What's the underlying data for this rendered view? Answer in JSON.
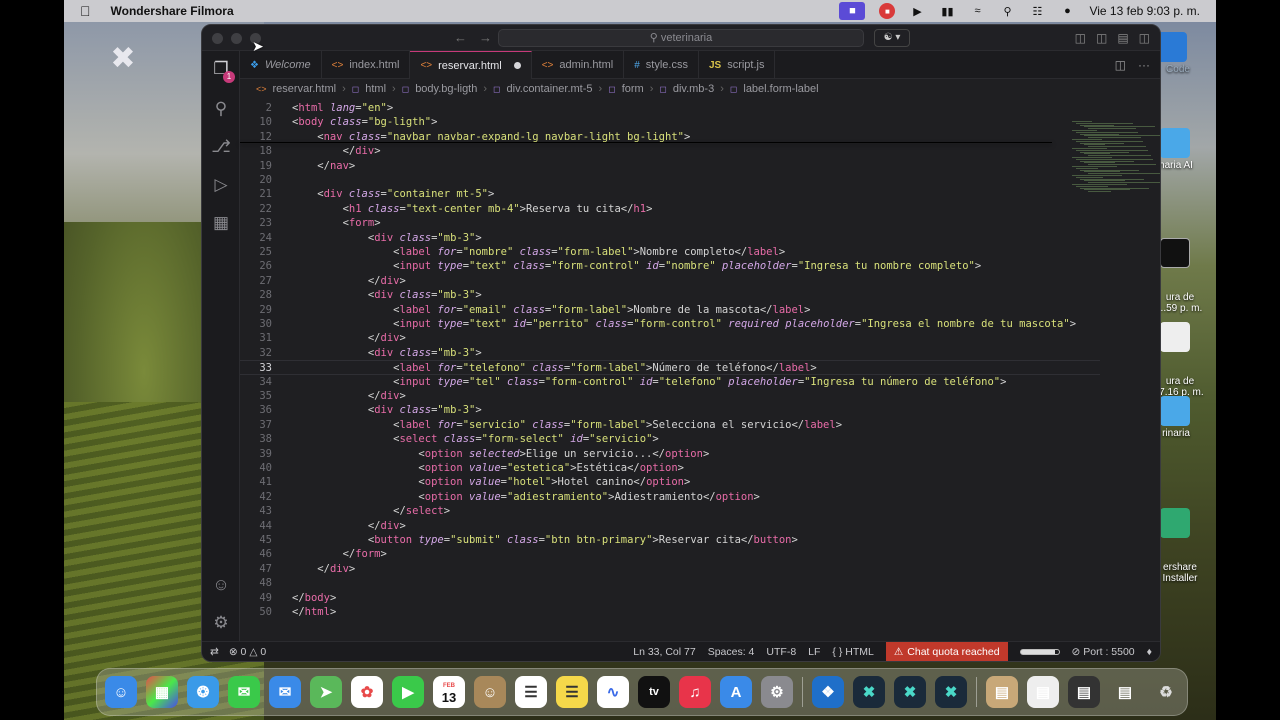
{
  "menubar": {
    "app_name": "Wondershare Filmora",
    "datetime": "Vie 13 feb  9:03 p. m."
  },
  "desktop_icons": [
    {
      "label": "Code"
    },
    {
      "label": "naria AI"
    },
    {
      "label": "ura de\n...59 p. m."
    },
    {
      "label": "ura de\n.7.16 p. m."
    },
    {
      "label": "rinaria"
    },
    {
      "label": "ershare\nInstaller"
    }
  ],
  "window": {
    "search": "veterinaria"
  },
  "tabs": [
    {
      "label": "Welcome",
      "icon": "vscode-icon"
    },
    {
      "label": "index.html",
      "icon": "html-icon"
    },
    {
      "label": "reservar.html",
      "icon": "html-icon",
      "active": true,
      "modified": true
    },
    {
      "label": "admin.html",
      "icon": "html-icon"
    },
    {
      "label": "style.css",
      "icon": "css-icon"
    },
    {
      "label": "script.js",
      "icon": "js-icon"
    }
  ],
  "breadcrumb": [
    "reservar.html",
    "html",
    "body.bg-ligth",
    "div.container.mt-5",
    "form",
    "div.mb-3",
    "label.form-label"
  ],
  "code_lines": [
    {
      "n": "2",
      "html": "<span class='t-br'>&lt;</span><span class='t-tag'>html</span> <span class='t-attr'>lang</span>=<span class='t-str'>\"en\"</span>&gt;"
    },
    {
      "n": "10",
      "html": "<span class='t-br'>&lt;</span><span class='t-tag'>body</span> <span class='t-attr'>class</span>=<span class='t-str'>\"bg-ligth\"</span>&gt;"
    },
    {
      "n": "12",
      "html": "    &lt;<span class='t-tag'>nav</span> <span class='t-attr'>class</span>=<span class='t-str'>\"navbar navbar-expand-lg navbar-light bg-light\"</span>&gt;"
    },
    {
      "n": "18",
      "html": "        &lt;/<span class='t-tag'>div</span>&gt;"
    },
    {
      "n": "19",
      "html": "    &lt;/<span class='t-tag'>nav</span>&gt;"
    },
    {
      "n": "20",
      "html": ""
    },
    {
      "n": "21",
      "html": "    &lt;<span class='t-tag'>div</span> <span class='t-attr'>class</span>=<span class='t-str'>\"container mt-5\"</span>&gt;"
    },
    {
      "n": "22",
      "html": "        &lt;<span class='t-tag'>h1</span> <span class='t-attr'>class</span>=<span class='t-str'>\"text-center mb-4\"</span>&gt;Reserva tu cita&lt;/<span class='t-tag'>h1</span>&gt;"
    },
    {
      "n": "23",
      "html": "        &lt;<span class='t-tag'>form</span>&gt;"
    },
    {
      "n": "24",
      "html": "            &lt;<span class='t-tag'>div</span> <span class='t-attr'>class</span>=<span class='t-str'>\"mb-3\"</span>&gt;"
    },
    {
      "n": "25",
      "html": "                &lt;<span class='t-tag'>label</span> <span class='t-attr'>for</span>=<span class='t-str'>\"nombre\"</span> <span class='t-attr'>class</span>=<span class='t-str'>\"form-label\"</span>&gt;Nombre completo&lt;/<span class='t-tag'>label</span>&gt;"
    },
    {
      "n": "26",
      "html": "                &lt;<span class='t-tag'>input</span> <span class='t-attr'>type</span>=<span class='t-str'>\"text\"</span> <span class='t-attr'>class</span>=<span class='t-str'>\"form-control\"</span> <span class='t-attr'>id</span>=<span class='t-str'>\"nombre\"</span> <span class='t-attr'>placeholder</span>=<span class='t-str'>\"Ingresa tu nombre completo\"</span>&gt;"
    },
    {
      "n": "27",
      "html": "            &lt;/<span class='t-tag'>div</span>&gt;"
    },
    {
      "n": "28",
      "html": "            &lt;<span class='t-tag'>div</span> <span class='t-attr'>class</span>=<span class='t-str'>\"mb-3\"</span>&gt;"
    },
    {
      "n": "29",
      "html": "                &lt;<span class='t-tag'>label</span> <span class='t-attr'>for</span>=<span class='t-str'>\"email\"</span> <span class='t-attr'>class</span>=<span class='t-str'>\"form-label\"</span>&gt;Nombre de la mascota&lt;/<span class='t-tag'>label</span>&gt;"
    },
    {
      "n": "30",
      "html": "                &lt;<span class='t-tag'>input</span> <span class='t-attr'>type</span>=<span class='t-str'>\"text\"</span> <span class='t-attr'>id</span>=<span class='t-str'>\"perrito\"</span> <span class='t-attr'>class</span>=<span class='t-str'>\"form-control\"</span> <span class='t-attr'>required</span> <span class='t-attr'>placeholder</span>=<span class='t-str'>\"Ingresa el nombre de tu mascota\"</span>&gt;"
    },
    {
      "n": "31",
      "html": "            &lt;/<span class='t-tag'>div</span>&gt;"
    },
    {
      "n": "32",
      "html": "            &lt;<span class='t-tag'>div</span> <span class='t-attr'>class</span>=<span class='t-str'>\"mb-3\"</span>&gt;"
    },
    {
      "n": "33",
      "html": "                &lt;<span class='t-tag'>label</span> <span class='t-attr'>for</span>=<span class='t-str'>\"telefono\"</span> <span class='t-attr'>class</span>=<span class='t-str'>\"form-label\"</span>&gt;Número de teléfono&lt;/<span class='t-tag'>label</span>&gt;",
      "current": true
    },
    {
      "n": "34",
      "html": "                &lt;<span class='t-tag'>input</span> <span class='t-attr'>type</span>=<span class='t-str'>\"tel\"</span> <span class='t-attr'>class</span>=<span class='t-str'>\"form-control\"</span> <span class='t-attr'>id</span>=<span class='t-str'>\"telefono\"</span> <span class='t-attr'>placeholder</span>=<span class='t-str'>\"Ingresa tu número de teléfono\"</span>&gt;"
    },
    {
      "n": "35",
      "html": "            &lt;/<span class='t-tag'>div</span>&gt;"
    },
    {
      "n": "36",
      "html": "            &lt;<span class='t-tag'>div</span> <span class='t-attr'>class</span>=<span class='t-str'>\"mb-3\"</span>&gt;"
    },
    {
      "n": "37",
      "html": "                &lt;<span class='t-tag'>label</span> <span class='t-attr'>for</span>=<span class='t-str'>\"servicio\"</span> <span class='t-attr'>class</span>=<span class='t-str'>\"form-label\"</span>&gt;Selecciona el servicio&lt;/<span class='t-tag'>label</span>&gt;"
    },
    {
      "n": "38",
      "html": "                &lt;<span class='t-tag'>select</span> <span class='t-attr'>class</span>=<span class='t-str'>\"form-select\"</span> <span class='t-attr'>id</span>=<span class='t-str'>\"servicio\"</span>&gt;"
    },
    {
      "n": "39",
      "html": "                    &lt;<span class='t-tag'>option</span> <span class='t-attr'>selected</span>&gt;Elige un servicio...&lt;/<span class='t-tag'>option</span>&gt;"
    },
    {
      "n": "40",
      "html": "                    &lt;<span class='t-tag'>option</span> <span class='t-attr'>value</span>=<span class='t-str'>\"estetica\"</span>&gt;Estética&lt;/<span class='t-tag'>option</span>&gt;"
    },
    {
      "n": "41",
      "html": "                    &lt;<span class='t-tag'>option</span> <span class='t-attr'>value</span>=<span class='t-str'>\"hotel\"</span>&gt;Hotel canino&lt;/<span class='t-tag'>option</span>&gt;"
    },
    {
      "n": "42",
      "html": "                    &lt;<span class='t-tag'>option</span> <span class='t-attr'>value</span>=<span class='t-str'>\"adiestramiento\"</span>&gt;Adiestramiento&lt;/<span class='t-tag'>option</span>&gt;"
    },
    {
      "n": "43",
      "html": "                &lt;/<span class='t-tag'>select</span>&gt;"
    },
    {
      "n": "44",
      "html": "            &lt;/<span class='t-tag'>div</span>&gt;"
    },
    {
      "n": "45",
      "html": "            &lt;<span class='t-tag'>button</span> <span class='t-attr'>type</span>=<span class='t-str'>\"submit\"</span> <span class='t-attr'>class</span>=<span class='t-str'>\"btn btn-primary\"</span>&gt;Reservar cita&lt;/<span class='t-tag'>button</span>&gt;"
    },
    {
      "n": "46",
      "html": "        &lt;/<span class='t-tag'>form</span>&gt;"
    },
    {
      "n": "47",
      "html": "    &lt;/<span class='t-tag'>div</span>&gt;"
    },
    {
      "n": "48",
      "html": ""
    },
    {
      "n": "49",
      "html": "&lt;/<span class='t-tag'>body</span>&gt;"
    },
    {
      "n": "50",
      "html": "&lt;/<span class='t-tag'>html</span>&gt;"
    }
  ],
  "statusbar": {
    "errors": "0",
    "warnings": "0",
    "position": "Ln 33, Col 77",
    "spaces": "Spaces: 4",
    "encoding": "UTF-8",
    "eol": "LF",
    "language": "HTML",
    "chat_quota": "Chat quota reached",
    "port": "Port : 5500"
  },
  "dock": {
    "calendar_month": "FEB",
    "calendar_day": "13",
    "tv_label": "tv"
  }
}
